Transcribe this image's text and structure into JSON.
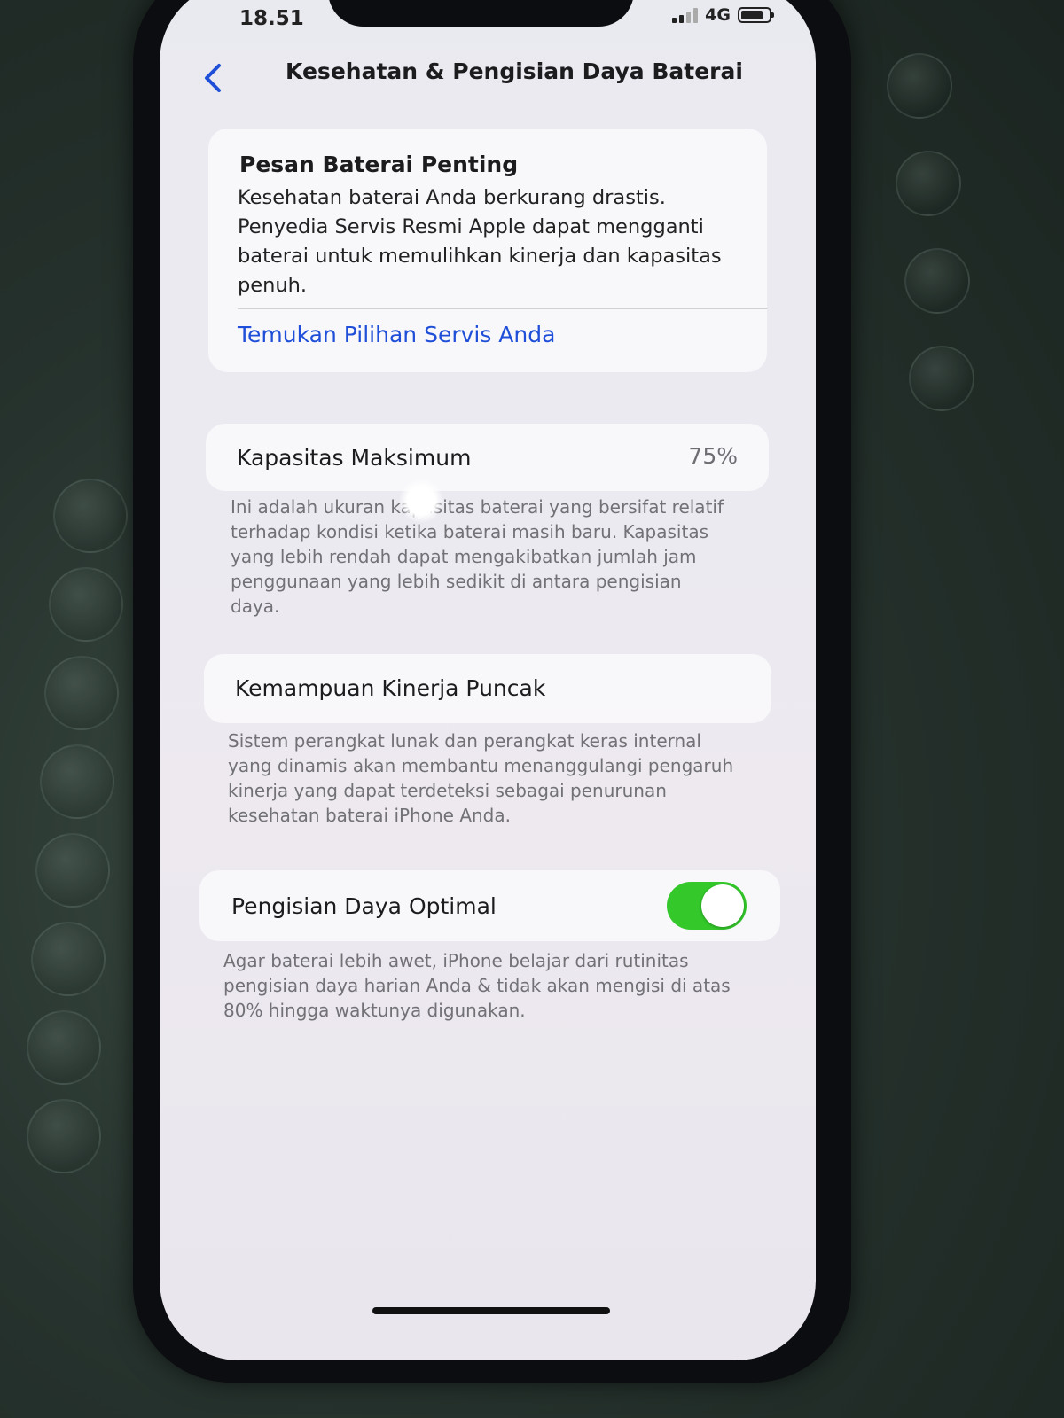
{
  "status_bar": {
    "time": "18.51",
    "network": "4G",
    "icons": [
      "signal-icon",
      "battery-icon"
    ]
  },
  "nav": {
    "back_icon": "chevron-left-icon",
    "title": "Kesehatan & Pengisian Daya Baterai"
  },
  "alert": {
    "title": "Pesan Baterai Penting",
    "body": "Kesehatan baterai Anda berkurang drastis. Penyedia Servis Resmi Apple dapat mengganti baterai untuk memulihkan kinerja dan kapasitas penuh.",
    "link": "Temukan Pilihan Servis Anda"
  },
  "capacity": {
    "label": "Kapasitas Maksimum",
    "value": "75%",
    "footnote": "Ini adalah ukuran kapasitas baterai yang bersifat relatif terhadap kondisi ketika baterai masih baru. Kapasitas yang lebih rendah dapat mengakibatkan jumlah jam penggunaan yang lebih sedikit di antara pengisian daya."
  },
  "performance": {
    "label": "Kemampuan Kinerja Puncak",
    "footnote": "Sistem perangkat lunak dan perangkat keras internal yang dinamis akan membantu menanggulangi pengaruh kinerja yang dapat terdeteksi sebagai penurunan kesehatan baterai iPhone Anda."
  },
  "optimal_charging": {
    "label": "Pengisian Daya Optimal",
    "enabled": true,
    "footnote": "Agar baterai lebih awet, iPhone belajar dari rutinitas pengisian daya harian Anda & tidak akan mengisi di atas 80% hingga waktunya digunakan."
  },
  "colors": {
    "link_blue": "#1f4fd8",
    "toggle_green": "#34c82b"
  }
}
